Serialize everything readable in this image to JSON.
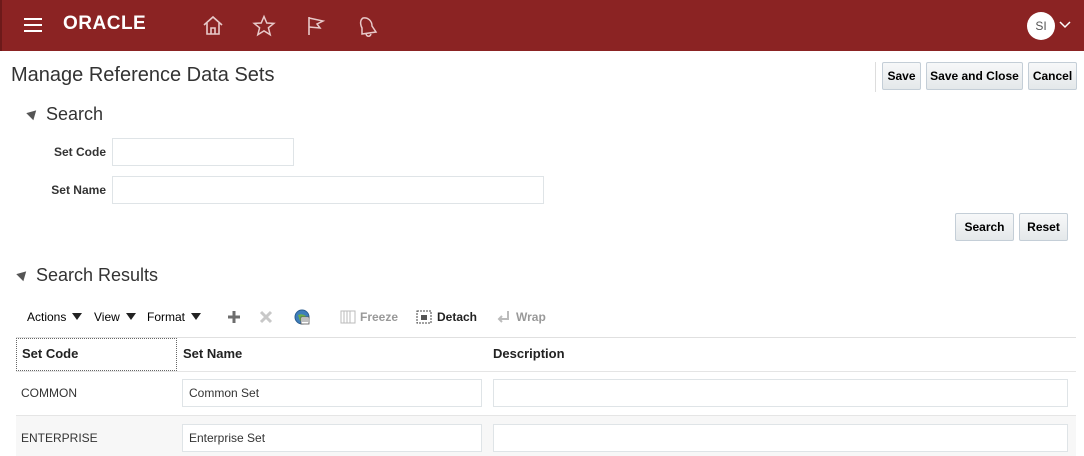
{
  "header": {
    "logo": "ORACLE",
    "avatar_initials": "SI",
    "bg_color": "#8b2323",
    "icons": [
      "menu-icon",
      "home-icon",
      "star-icon",
      "flag-icon",
      "bell-icon"
    ]
  },
  "page": {
    "title": "Manage Reference Data Sets",
    "buttons": {
      "save": "Save",
      "save_close": "Save and Close",
      "cancel": "Cancel"
    }
  },
  "search": {
    "heading": "Search",
    "set_code_label": "Set Code",
    "set_code_value": "",
    "set_name_label": "Set Name",
    "set_name_value": "",
    "search_button": "Search",
    "reset_button": "Reset"
  },
  "results": {
    "heading": "Search Results",
    "toolbar": {
      "actions": "Actions",
      "view": "View",
      "format": "Format",
      "freeze": "Freeze",
      "detach": "Detach",
      "wrap": "Wrap"
    },
    "columns": [
      "Set Code",
      "Set Name",
      "Description"
    ],
    "rows": [
      {
        "set_code": "COMMON",
        "set_name": "Common Set",
        "description": ""
      },
      {
        "set_code": "ENTERPRISE",
        "set_name": "Enterprise Set",
        "description": ""
      }
    ]
  }
}
